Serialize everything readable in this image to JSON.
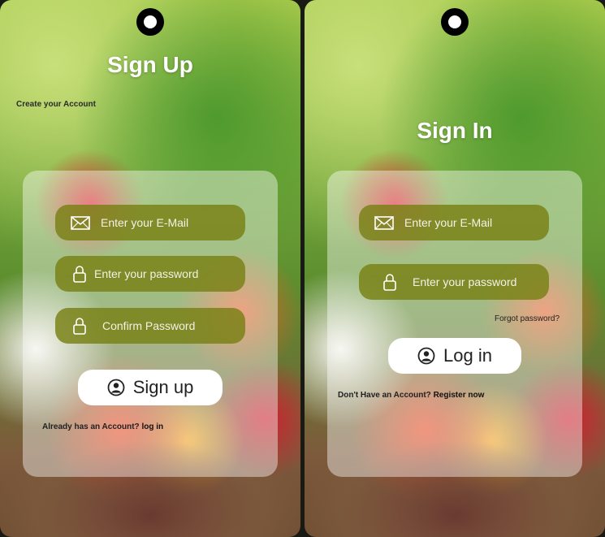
{
  "signup": {
    "title": "Sign Up",
    "subtitle": "Create your Account",
    "email_placeholder": "Enter your E-Mail",
    "password_placeholder": "Enter your password",
    "confirm_placeholder": "Confirm Password",
    "button_label": "Sign up",
    "footer_text": "Already has an Account? ",
    "footer_link": "log in"
  },
  "signin": {
    "title": "Sign In",
    "email_placeholder": "Enter your E-Mail",
    "password_placeholder": "Enter your password",
    "forgot_label": "Forgot password?",
    "button_label": "Log in",
    "footer_text": "Don't Have an Account? ",
    "footer_link": "Register now"
  },
  "icons": {
    "email": "envelope-icon",
    "password": "lock-icon",
    "user": "user-circle-icon",
    "camera": "camera-icon"
  },
  "colors": {
    "field_bg": "#78801a",
    "card_bg": "#ffffff",
    "button_bg": "#ffffff"
  }
}
